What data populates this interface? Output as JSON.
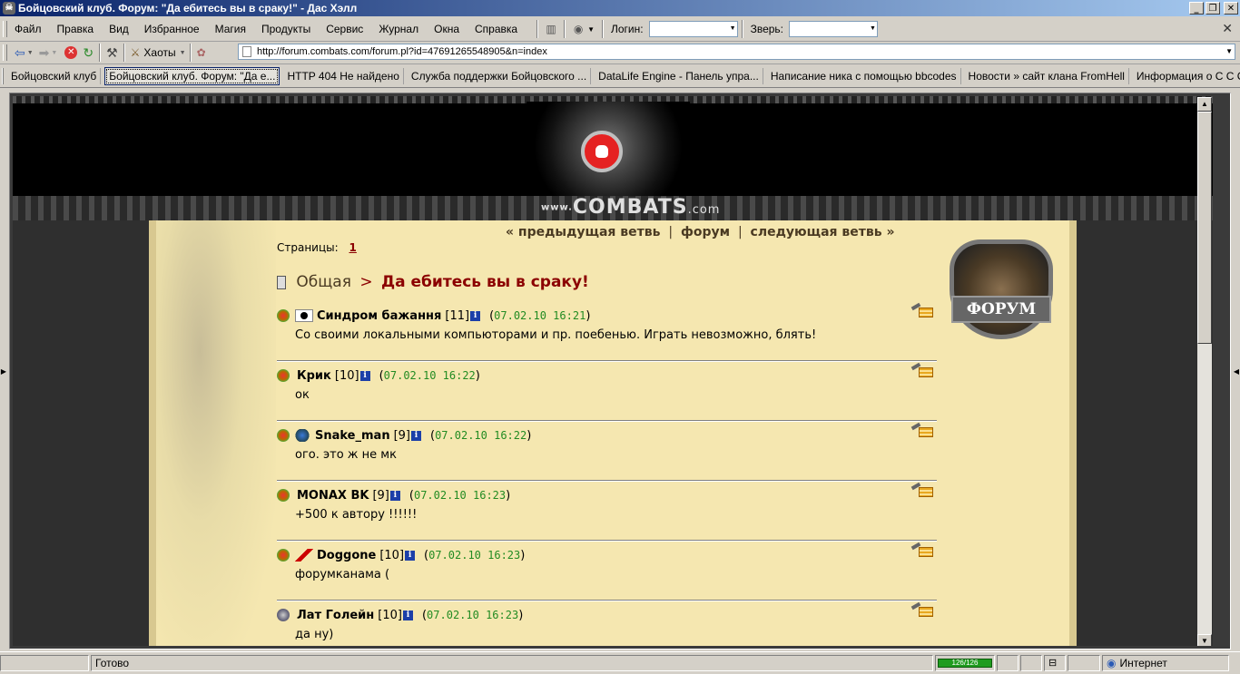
{
  "window": {
    "title": "Бойцовский клуб. Форум: \"Да ебитесь вы в сраку!\" - Дас Хэлл"
  },
  "menu": {
    "items": [
      "Файл",
      "Правка",
      "Вид",
      "Избранное",
      "Магия",
      "Продукты",
      "Сервис",
      "Журнал",
      "Окна",
      "Справка"
    ],
    "login_label": "Логин:",
    "beast_label": "Зверь:"
  },
  "nav": {
    "haoty_label": "Хаоты",
    "url": "http://forum.combats.com/forum.pl?id=47691265548905&n=index"
  },
  "tabs": [
    {
      "label": "Бойцовский клуб",
      "active": false
    },
    {
      "label": "Бойцовский клуб. Форум: \"Да е...",
      "active": true
    },
    {
      "label": "HTTP 404 Не найдено",
      "active": false
    },
    {
      "label": "Служба поддержки Бойцовского ...",
      "active": false
    },
    {
      "label": "DataLife Engine - Панель упра...",
      "active": false
    },
    {
      "label": "Написание ника с помощью bbcodes",
      "active": false
    },
    {
      "label": "Новости » сайт клана FromHell",
      "active": false
    },
    {
      "label": "Информация о С С С",
      "active": false
    }
  ],
  "site": {
    "logo_prefix": "www.",
    "logo_text": "COMBATS",
    "logo_suffix": ".com",
    "shield_label": "ФОРУМ"
  },
  "forum": {
    "prev_thread": "« предыдущая ветвь",
    "forum_link": "форум",
    "next_thread": "следующая ветвь »",
    "pages_label": "Страницы:",
    "current_page": "1",
    "breadcrumb_section": "Общая",
    "breadcrumb_sep": ">",
    "thread_title": "Да ебитесь вы в сраку!",
    "posts": [
      {
        "nick": "Синдром бажання",
        "level": "[11]",
        "date": "07.02.10 16:21",
        "text": "Со своими локальными компьюторами и пр. поебенью. Играть невозможно, блять!",
        "align": "a1",
        "clan": "clan"
      },
      {
        "nick": "Крик",
        "level": "[10]",
        "date": "07.02.10 16:22",
        "text": "ок",
        "align": "",
        "clan": "clan"
      },
      {
        "nick": "Snake_man",
        "level": "[9]",
        "date": "07.02.10 16:22",
        "text": "ого. это ж не мк",
        "align": "a2",
        "clan": "clan"
      },
      {
        "nick": "MONAX BK",
        "level": "[9]",
        "date": "07.02.10 16:23",
        "text": "+500 к автору !!!!!!",
        "align": "",
        "clan": "clan"
      },
      {
        "nick": "Doggone",
        "level": "[10]",
        "date": "07.02.10 16:23",
        "text": "форумканама (",
        "align": "a3",
        "clan": "clan"
      },
      {
        "nick": "Лат Голейн",
        "level": "[10]",
        "date": "07.02.10 16:23",
        "text": "да ну)",
        "align": "",
        "clan": "sil"
      }
    ]
  },
  "status": {
    "text": "Готово",
    "progress": "126/126",
    "zone": "Интернет"
  }
}
